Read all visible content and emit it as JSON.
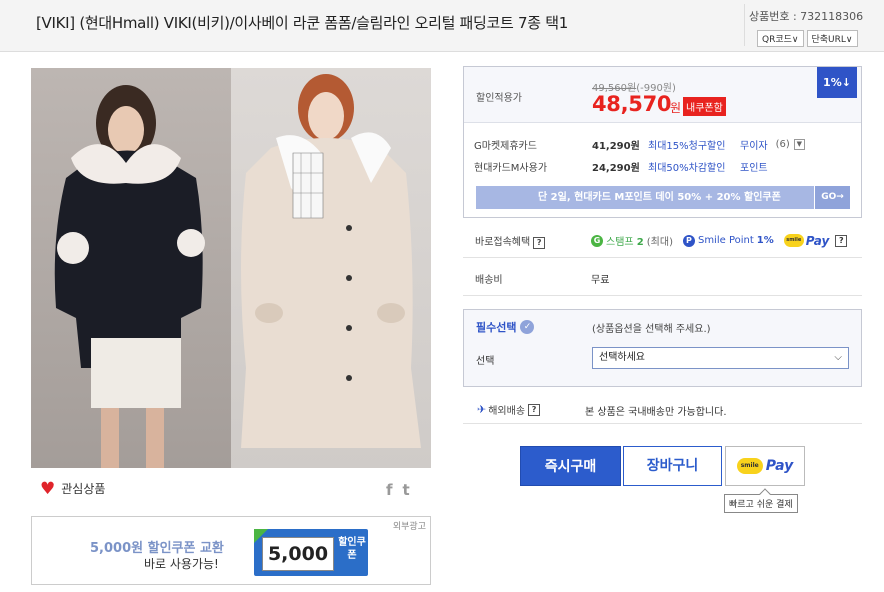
{
  "header": {
    "title": "[VIKI] (현대Hmall) VIKI(비키)/이사베이 라쿤 폼폼/슬림라인 오리털 패딩코트 7종 택1",
    "product_no_label": "상품번호 : 732118306",
    "qr_label": "QR코드∨",
    "short_url_label": "단축URL∨"
  },
  "gallery": {
    "favorite_label": "관심상품",
    "facebook_label": "f",
    "twitter_label": "t"
  },
  "coupon_banner": {
    "ad_label": "외부광고",
    "line1": "5,000원 할인쿠폰 교환",
    "line2": "바로 사용가능!",
    "ticket_amount": "5,000",
    "ticket_side": "할인쿠폰"
  },
  "price": {
    "label": "할인적용가",
    "original": "49,560원",
    "discount": "(-990원)",
    "final": "48,570",
    "won": "원",
    "my_coupon": "내쿠폰함",
    "percent_badge": "1%↓",
    "cards": [
      {
        "name": "G마켓제휴카드",
        "amount": "41,290원",
        "desc": "최대15%청구할인",
        "link": "무이자",
        "count": "(6)"
      },
      {
        "name": "현대카드M사용가",
        "amount": "24,290원",
        "desc": "최대50%차감할인",
        "link": "포인트",
        "count": ""
      }
    ],
    "promo_text": "단 2일, 현대카드 M포인트 데이 50% + 20% 할인쿠폰",
    "promo_go": "GO→"
  },
  "benefits": {
    "label": "바로접속혜택",
    "stamp_label": "스탬프",
    "stamp_count": "2",
    "stamp_max": "(최대)",
    "smile_point_label": "Smile Point",
    "smile_point_value": "1%",
    "smile_pay_label": "Pay"
  },
  "shipping_fee": {
    "label": "배송비",
    "value": "무료"
  },
  "options": {
    "title": "필수선택",
    "hint": "(상품옵션을 선택해 주세요.)",
    "select_label": "선택",
    "select_value": "선택하세요"
  },
  "overseas": {
    "label": "해외배송",
    "value": "본 상품은 국내배송만 가능합니다."
  },
  "actions": {
    "buy_now": "즉시구매",
    "cart": "장바구니",
    "smile_pay": "Pay",
    "smile_pay_tooltip": "빠르고 쉬운 결제"
  },
  "colors": {
    "accent_blue": "#2c5ccc",
    "price_red": "#e8231f",
    "stamp_green": "#4bb543"
  }
}
